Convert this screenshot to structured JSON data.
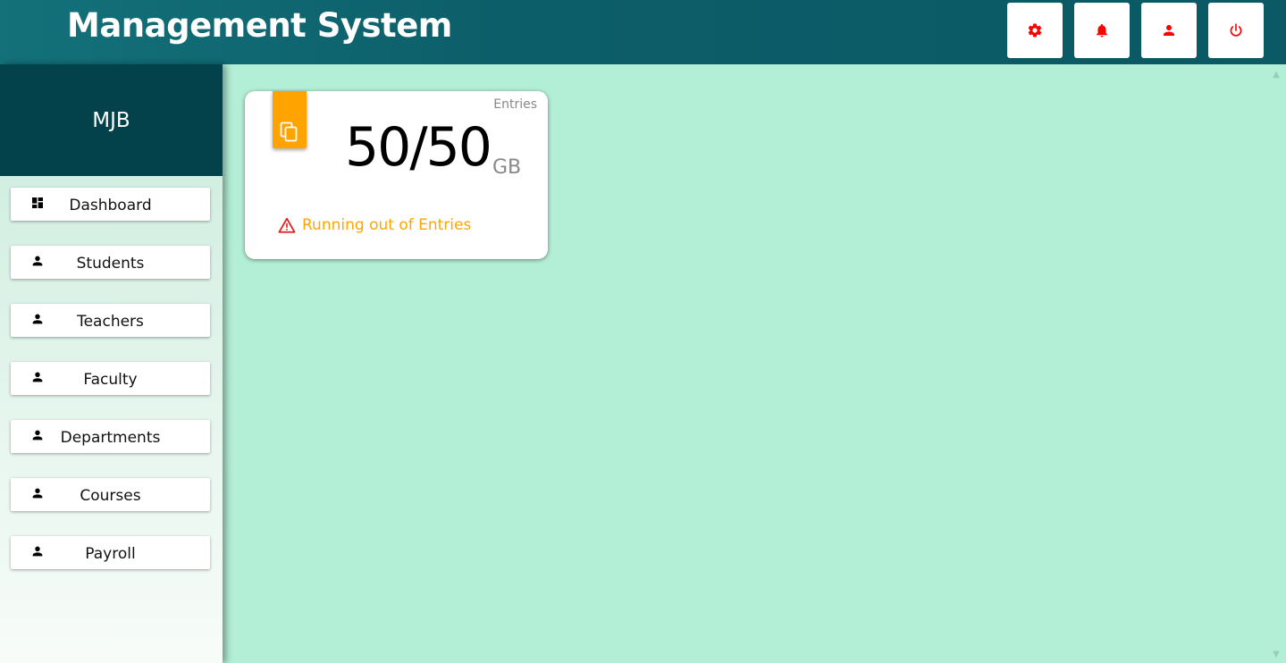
{
  "header": {
    "title": "Management System",
    "buttons": [
      {
        "name": "settings",
        "icon": "gear-icon"
      },
      {
        "name": "notifications",
        "icon": "bell-icon"
      },
      {
        "name": "profile",
        "icon": "user-icon"
      },
      {
        "name": "logout",
        "icon": "power-icon"
      }
    ],
    "icon_color": "#ff0000"
  },
  "sidebar": {
    "brand": "MJB",
    "items": [
      {
        "label": "Dashboard",
        "icon": "dashboard-icon"
      },
      {
        "label": "Students",
        "icon": "person-icon"
      },
      {
        "label": "Teachers",
        "icon": "person-icon"
      },
      {
        "label": "Faculty",
        "icon": "person-icon"
      },
      {
        "label": "Departments",
        "icon": "person-icon"
      },
      {
        "label": "Courses",
        "icon": "person-icon"
      },
      {
        "label": "Payroll",
        "icon": "person-icon"
      }
    ]
  },
  "card": {
    "category": "Entries",
    "value": "50/50",
    "unit": "GB",
    "icon": "copy-icon",
    "warning_icon": "warning-icon",
    "warning": "Running out of Entries",
    "badge_color": "#ffa300",
    "warning_color": "#ffa500"
  },
  "colors": {
    "header": "#0c5e69",
    "brand_bg": "#03424a",
    "main_bg": "#b3eed6"
  }
}
